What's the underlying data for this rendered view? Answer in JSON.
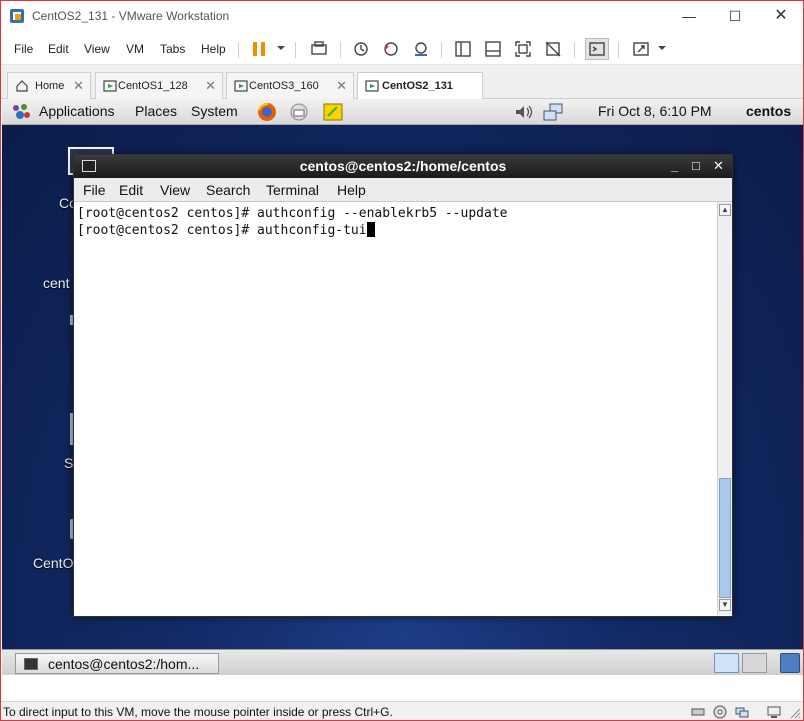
{
  "window": {
    "title": "CentOS2_131 - VMware Workstation"
  },
  "menu": [
    "File",
    "Edit",
    "View",
    "VM",
    "Tabs",
    "Help"
  ],
  "tabs": [
    {
      "label": "Home"
    },
    {
      "label": "CentOS1_128"
    },
    {
      "label": "CentOS3_160"
    },
    {
      "label": "CentOS2_131",
      "active": true
    }
  ],
  "guest_panel": {
    "items": [
      "Applications",
      "Places",
      "System"
    ],
    "clock": "Fri Oct  8,  6:10 PM",
    "user": "centos"
  },
  "desktop_labels": [
    "Co",
    "cent",
    "S",
    "CentO"
  ],
  "terminal": {
    "title": "centos@centos2:/home/centos",
    "menu": [
      "File",
      "Edit",
      "View",
      "Search",
      "Terminal",
      "Help"
    ],
    "lines": [
      "[root@centos2 centos]# authconfig --enablekrb5 --update",
      "[root@centos2 centos]# authconfig-tui"
    ]
  },
  "taskbar": {
    "label": "centos@centos2:/hom..."
  },
  "statusbar": {
    "text": "To direct input to this VM, move the mouse pointer inside or press Ctrl+G."
  },
  "colors": {
    "accent_pause": "#f28c00",
    "guest_bg": "#122a66",
    "border": "#d9363e"
  },
  "icons": [
    "vmware-icon",
    "pause-icon",
    "snapshot-icon",
    "fullscreen-icon",
    "console-icon",
    "firefox-icon",
    "mail-icon",
    "note-icon",
    "volume-icon",
    "network-icon"
  ]
}
